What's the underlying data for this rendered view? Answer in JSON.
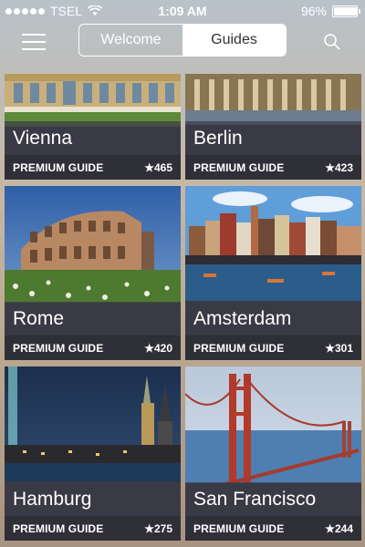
{
  "status_bar": {
    "carrier": "TSEL",
    "time": "1:09 AM",
    "battery_percent": "96%",
    "battery_level": 0.96
  },
  "nav": {
    "tabs": [
      {
        "label": "Welcome",
        "selected": false
      },
      {
        "label": "Guides",
        "selected": true
      }
    ],
    "menu_icon": "hamburger-icon",
    "search_icon": "search-icon"
  },
  "guides": [
    {
      "city": "Vienna",
      "label": "PREMIUM GUIDE",
      "rating": "★465"
    },
    {
      "city": "Berlin",
      "label": "PREMIUM GUIDE",
      "rating": "★423"
    },
    {
      "city": "Rome",
      "label": "PREMIUM GUIDE",
      "rating": "★420"
    },
    {
      "city": "Amsterdam",
      "label": "PREMIUM GUIDE",
      "rating": "★301"
    },
    {
      "city": "Hamburg",
      "label": "PREMIUM GUIDE",
      "rating": "★275"
    },
    {
      "city": "San Francisco",
      "label": "PREMIUM GUIDE",
      "rating": "★244"
    }
  ]
}
